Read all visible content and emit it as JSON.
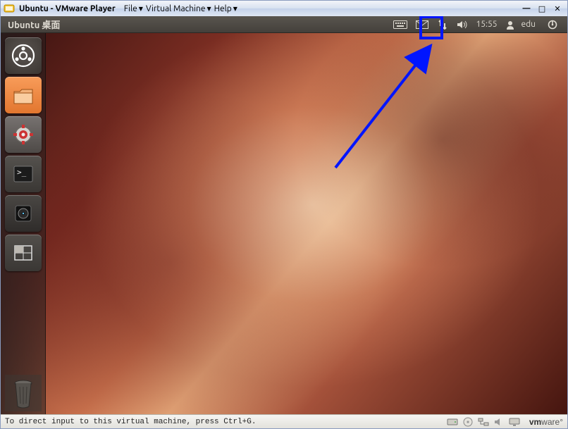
{
  "vmware": {
    "title": "Ubuntu - VMware Player",
    "menu": {
      "file": "File",
      "vm": "Virtual Machine",
      "help": "Help"
    },
    "status_text": "To direct input to this virtual machine, press Ctrl+G.",
    "brand_prefix": "vm",
    "brand_suffix": "ware"
  },
  "ubuntu": {
    "menubar_title": "Ubuntu 桌面",
    "time": "15:55",
    "user": "edu"
  },
  "launcher": {
    "items": [
      {
        "name": "dash"
      },
      {
        "name": "home-folder"
      },
      {
        "name": "system-settings"
      },
      {
        "name": "terminal"
      },
      {
        "name": "backup"
      },
      {
        "name": "workspace-switcher"
      }
    ],
    "trash": "trash"
  }
}
